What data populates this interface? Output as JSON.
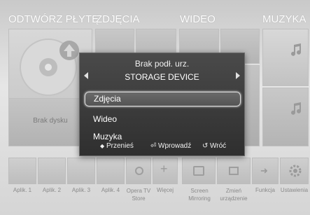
{
  "categories": [
    "ODTWÓRZ PŁYTĘ",
    "ZDJĘCIA",
    "WIDEO",
    "MUZYKA"
  ],
  "disc_tile_label": "Brak dysku",
  "apps": [
    {
      "label": "Aplik. 1"
    },
    {
      "label": "Aplik. 2"
    },
    {
      "label": "Aplik. 3"
    },
    {
      "label": "Aplik. 4"
    },
    {
      "label": "Opera TV Store"
    },
    {
      "label": "Więcej"
    },
    {
      "label": "Screen Mirroring"
    },
    {
      "label": "Zmień urządzenie"
    },
    {
      "label": "Funkcja"
    },
    {
      "label": "Ustawienia"
    }
  ],
  "dialog": {
    "title": "Brak podł. urz.",
    "device": "STORAGE DEVICE",
    "items": [
      "Zdjęcia",
      "Wideo",
      "Muzyka"
    ],
    "selected_index": 0,
    "footer": {
      "move_icon": "◆",
      "move": "Przenieś",
      "enter_icon": "⏎",
      "enter": "Wprowadź",
      "back_icon": "↺",
      "back": "Wróć"
    }
  }
}
